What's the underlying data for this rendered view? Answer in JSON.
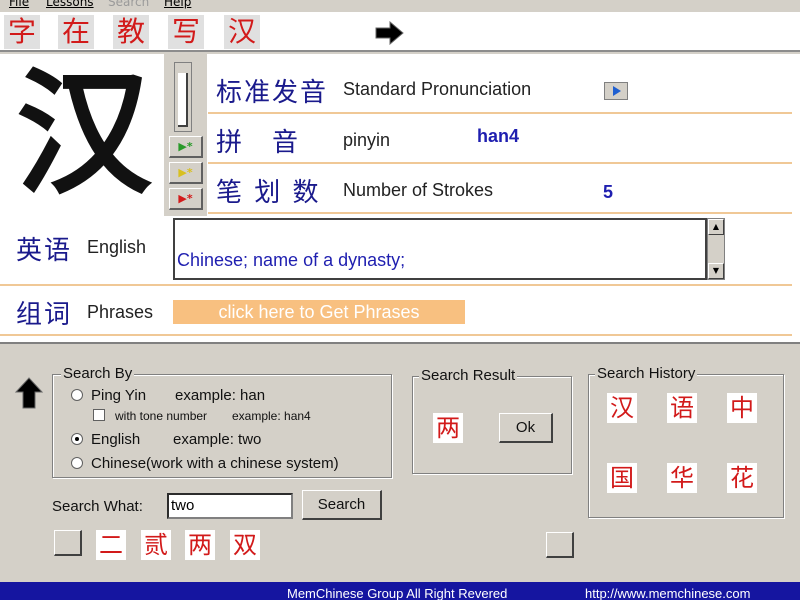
{
  "menu": [
    "File",
    "Lessons",
    "Search",
    "Help"
  ],
  "top_words": [
    "字",
    "在",
    "教",
    "写",
    "汉"
  ],
  "current": {
    "character": "汉",
    "pron_cn": "标准发音",
    "pron_en": "Standard Pronunciation",
    "pinyin_cn": "拼　音",
    "pinyin_en": "pinyin",
    "pinyin_value": "han4",
    "strokes_cn": "笔 划 数",
    "strokes_en": "Number of Strokes",
    "strokes_value": "5",
    "english_cn": "英语",
    "english_en": "English",
    "meaning": "Chinese; name of a dynasty;",
    "phrases_cn": "组词",
    "phrases_en": "Phrases",
    "phrases_button": "click here to Get Phrases"
  },
  "search_by": {
    "title": "Search By",
    "option1": "Ping Yin",
    "option1_example": "example: han",
    "tone_label": "with tone number",
    "tone_example": "example: han4",
    "option2": "English",
    "option2_example": "example: two",
    "option3": "Chinese(work with  a chinese system)"
  },
  "search_what_label": "Search What:",
  "search_value": "two",
  "search_button": "Search",
  "results_chars": [
    "二",
    "贰",
    "两",
    "双"
  ],
  "search_result": {
    "title": "Search Result",
    "char": "两",
    "ok": "Ok"
  },
  "history": {
    "title": "Search History",
    "chars": [
      "汉",
      "语",
      "中",
      "国",
      "华",
      "花"
    ]
  },
  "footer": {
    "company": "MemChinese Group All Right Revered",
    "url": "http://www.memchinese.com"
  }
}
